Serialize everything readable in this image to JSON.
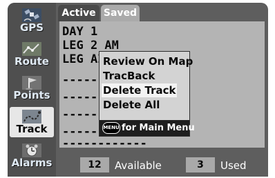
{
  "sidebar": {
    "items": [
      {
        "label": "GPS",
        "icon": "gps-satellite-icon",
        "selected": false
      },
      {
        "label": "Route",
        "icon": "route-map-icon",
        "selected": false
      },
      {
        "label": "Points",
        "icon": "points-flag-icon",
        "selected": false
      },
      {
        "label": "Track",
        "icon": "track-trail-icon",
        "selected": true
      },
      {
        "label": "Alarms",
        "icon": "alarm-clock-icon",
        "selected": false
      }
    ]
  },
  "tabs": [
    {
      "label": "Active",
      "selected": false
    },
    {
      "label": "Saved",
      "selected": true
    }
  ],
  "track_list": {
    "items": [
      "DAY 1",
      "LEG 2 AM",
      "LEG AI"
    ],
    "empty_placeholder": "------------"
  },
  "context_menu": {
    "items": [
      {
        "label": "Review On Map",
        "selected": false
      },
      {
        "label": "TracBack",
        "selected": false
      },
      {
        "label": "Delete Track",
        "selected": true
      },
      {
        "label": "Delete All",
        "selected": false
      }
    ],
    "footer": {
      "key_label": "MENU",
      "text": "for Main Menu"
    }
  },
  "status": {
    "available_count": "12",
    "available_label": "Available",
    "used_count": "3",
    "used_label": "Used"
  },
  "colors": {
    "background": "#5e5e5e",
    "content_panel": "#b4b4b4",
    "selected_item": "#e7e7e7",
    "popup_footer": "#1e1e1e",
    "label_text": "#dfe9f3"
  }
}
